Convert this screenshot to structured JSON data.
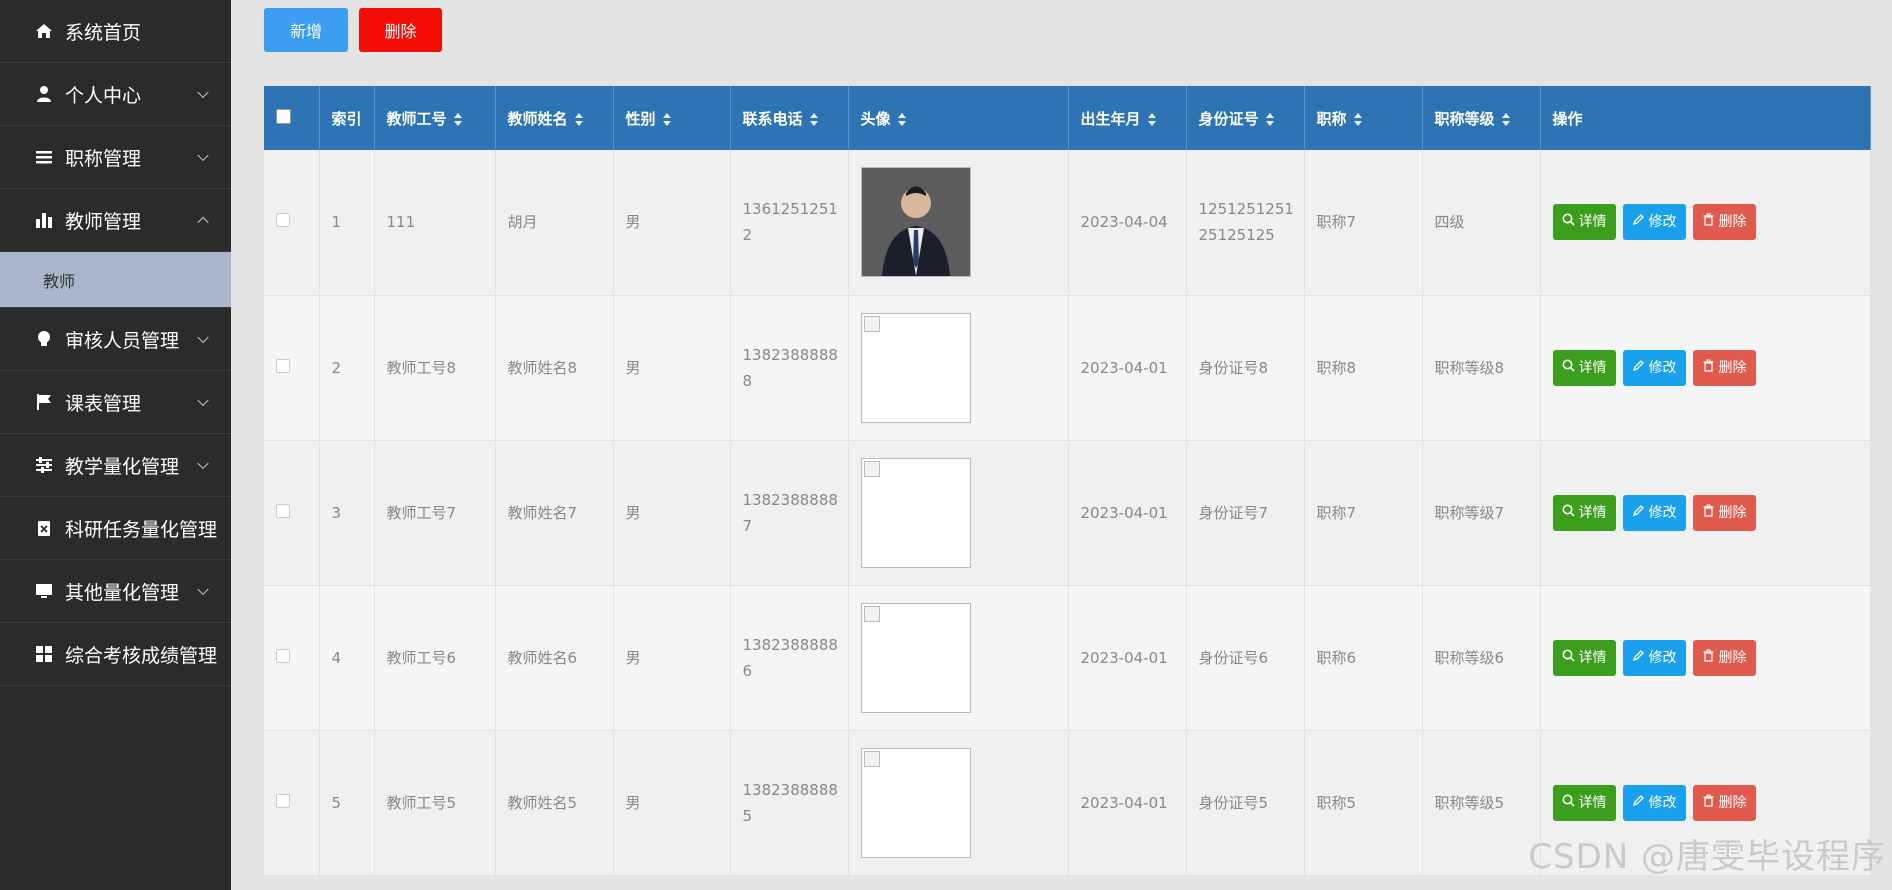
{
  "sidebar": {
    "items": [
      {
        "label": "系统首页",
        "icon": "home-icon"
      },
      {
        "label": "个人中心",
        "icon": "user-icon",
        "chevron": "down"
      },
      {
        "label": "职称管理",
        "icon": "list-icon",
        "chevron": "down"
      },
      {
        "label": "教师管理",
        "icon": "bar-chart-icon",
        "chevron": "up"
      },
      {
        "label": "审核人员管理",
        "icon": "lightbulb-icon",
        "chevron": "down"
      },
      {
        "label": "课表管理",
        "icon": "flag-icon",
        "chevron": "down"
      },
      {
        "label": "教学量化管理",
        "icon": "sliders-icon",
        "chevron": "down"
      },
      {
        "label": "科研任务量化管理",
        "icon": "clipboard-icon"
      },
      {
        "label": "其他量化管理",
        "icon": "monitor-icon",
        "chevron": "down"
      },
      {
        "label": "综合考核成绩管理",
        "icon": "grid-icon"
      }
    ],
    "active_sub": "教师"
  },
  "toolbar": {
    "add_label": "新增",
    "delete_label": "删除"
  },
  "table": {
    "headers": [
      "索引",
      "教师工号",
      "教师姓名",
      "性别",
      "联系电话",
      "头像",
      "出生年月",
      "身份证号",
      "职称",
      "职称等级",
      "操作"
    ],
    "rows": [
      {
        "index": "1",
        "teacher_id": "111",
        "name": "胡月",
        "gender": "男",
        "phone": "13612512512",
        "birth": "2023-04-04",
        "id_card": "125125125125125125",
        "title": "职称7",
        "level": "四级",
        "photo": true
      },
      {
        "index": "2",
        "teacher_id": "教师工号8",
        "name": "教师姓名8",
        "gender": "男",
        "phone": "13823888888",
        "birth": "2023-04-01",
        "id_card": "身份证号8",
        "title": "职称8",
        "level": "职称等级8",
        "photo": false
      },
      {
        "index": "3",
        "teacher_id": "教师工号7",
        "name": "教师姓名7",
        "gender": "男",
        "phone": "13823888887",
        "birth": "2023-04-01",
        "id_card": "身份证号7",
        "title": "职称7",
        "level": "职称等级7",
        "photo": false
      },
      {
        "index": "4",
        "teacher_id": "教师工号6",
        "name": "教师姓名6",
        "gender": "男",
        "phone": "13823888886",
        "birth": "2023-04-01",
        "id_card": "身份证号6",
        "title": "职称6",
        "level": "职称等级6",
        "photo": false
      },
      {
        "index": "5",
        "teacher_id": "教师工号5",
        "name": "教师姓名5",
        "gender": "男",
        "phone": "13823888885",
        "birth": "2023-04-01",
        "id_card": "身份证号5",
        "title": "职称5",
        "level": "职称等级5",
        "photo": false
      }
    ],
    "actions": {
      "detail": "详情",
      "edit": "修改",
      "delete": "删除"
    }
  },
  "watermark": "CSDN @唐雯毕设程序",
  "colors": {
    "header_blue": "#2e74b5",
    "add_blue": "#3d9df1",
    "delete_red": "#f50d05",
    "detail_green": "#3b9e1d",
    "edit_blue": "#1aa1ed",
    "row_delete_red": "#e05a4e"
  }
}
